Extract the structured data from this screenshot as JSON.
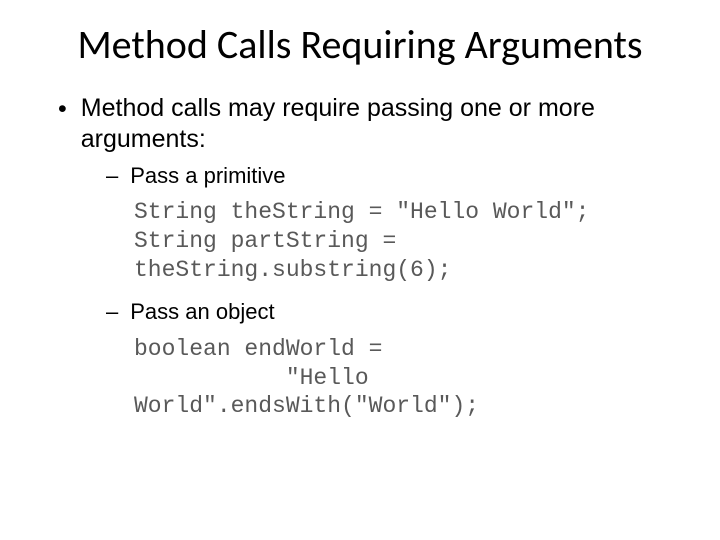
{
  "title": "Method Calls Requiring Arguments",
  "intro": "Method calls may require passing one or more arguments:",
  "items": [
    {
      "label": "Pass a primitive",
      "code": "String theString = \"Hello World\";\nString partString = \ntheString.substring(6);"
    },
    {
      "label": "Pass an object",
      "code": "boolean endWorld = \n           \"Hello \nWorld\".endsWith(\"World\");"
    }
  ]
}
